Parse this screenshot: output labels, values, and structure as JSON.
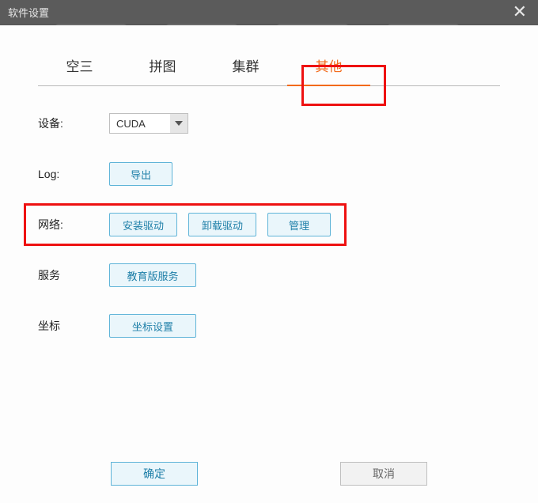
{
  "window": {
    "title": "软件设置",
    "close": "✕"
  },
  "tabs": {
    "items": [
      "空三",
      "拼图",
      "集群",
      "其他"
    ],
    "active_index": 3
  },
  "rows": {
    "device": {
      "label": "设备:",
      "value": "CUDA"
    },
    "log": {
      "label": "Log:",
      "export": "导出"
    },
    "network": {
      "label": "网络:",
      "install": "安装驱动",
      "uninstall": "卸载驱动",
      "manage": "管理"
    },
    "service": {
      "label": "服务",
      "edu": "教育版服务"
    },
    "coord": {
      "label": "坐标",
      "settings": "坐标设置"
    }
  },
  "footer": {
    "ok": "确定",
    "cancel": "取消"
  }
}
